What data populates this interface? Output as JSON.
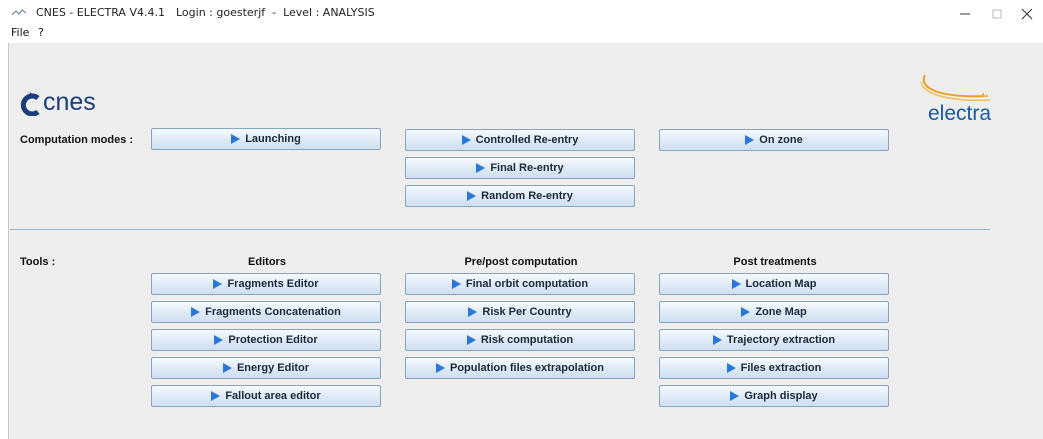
{
  "window": {
    "title": "CNES - ELECTRA V4.4.1",
    "login_info": "Login : goesterjf  -  Level : ANALYSIS",
    "controls": {
      "minimize": "minimize-icon",
      "maximize": "maximize-icon",
      "close": "close-icon"
    }
  },
  "menu": {
    "items": [
      "File",
      "?"
    ]
  },
  "logos": {
    "cnes": "cnes",
    "electra": "electra"
  },
  "computation": {
    "label": "Computation modes :",
    "buttons": [
      "Launching",
      "Controlled Re-entry",
      "Final Re-entry",
      "Random Re-entry",
      "On zone"
    ]
  },
  "tools": {
    "label": "Tools :",
    "editors": {
      "header": "Editors",
      "buttons": [
        "Fragments Editor",
        "Fragments Concatenation",
        "Protection Editor",
        "Energy Editor",
        "Fallout area editor"
      ]
    },
    "prepost": {
      "header": "Pre/post computation",
      "buttons": [
        "Final orbit computation",
        "Risk Per Country",
        "Risk computation",
        "Population files extrapolation"
      ]
    },
    "post": {
      "header": "Post treatments",
      "buttons": [
        "Location Map",
        "Zone Map",
        "Trajectory extraction",
        "Files extraction",
        "Graph display"
      ]
    }
  },
  "colors": {
    "accent": "#2a78d6",
    "cnes_blue": "#1b3d7a",
    "electra_blue": "#1a5aa0",
    "electra_orange": "#f0a020"
  }
}
